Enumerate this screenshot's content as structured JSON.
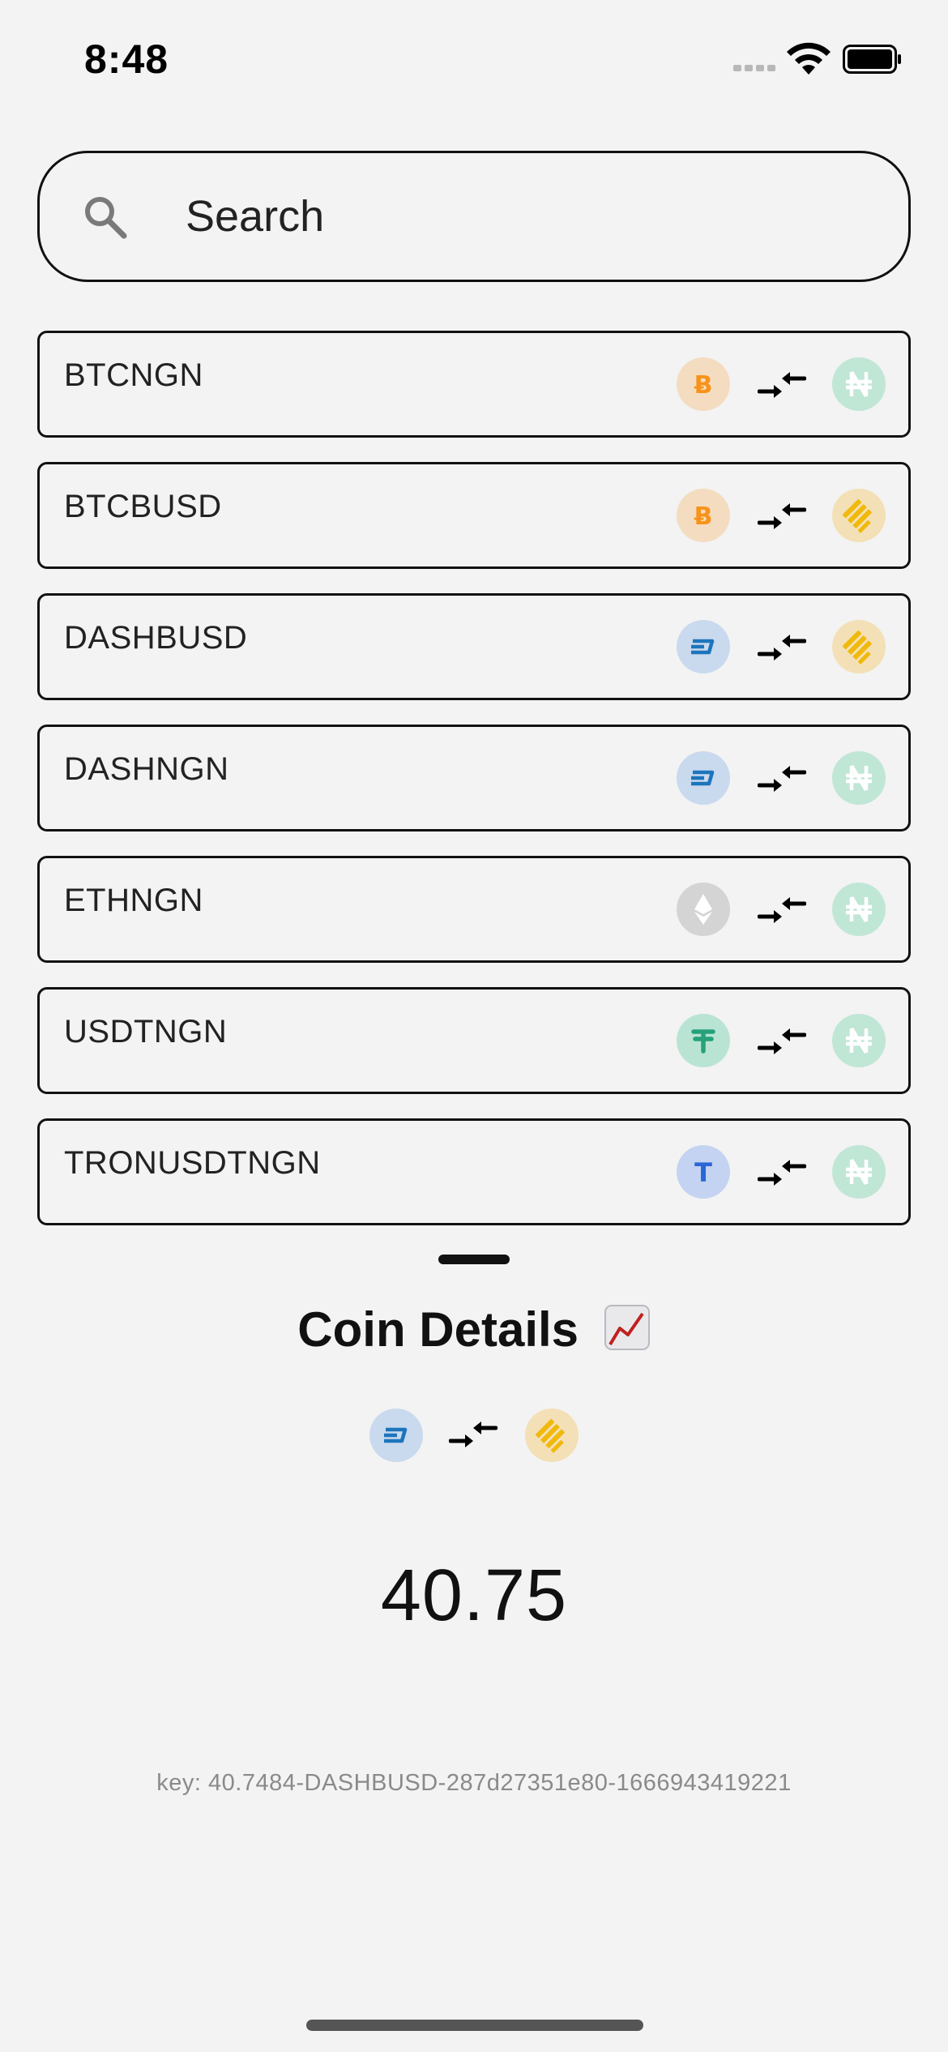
{
  "status_bar": {
    "time": "8:48"
  },
  "search": {
    "placeholder": "Search"
  },
  "pairs": [
    {
      "label": "BTCNGN",
      "base": "btc",
      "quote": "ngn"
    },
    {
      "label": "BTCBUSD",
      "base": "btc",
      "quote": "busd"
    },
    {
      "label": "DASHBUSD",
      "base": "dash",
      "quote": "busd"
    },
    {
      "label": "DASHNGN",
      "base": "dash",
      "quote": "ngn"
    },
    {
      "label": "ETHNGN",
      "base": "eth",
      "quote": "ngn"
    },
    {
      "label": "USDTNGN",
      "base": "usdt",
      "quote": "ngn"
    },
    {
      "label": "TRONUSDTNGN",
      "base": "tron",
      "quote": "ngn"
    }
  ],
  "icons": {
    "btc": "bitcoin-icon",
    "dash": "dash-icon",
    "eth": "ethereum-icon",
    "usdt": "tether-icon",
    "tron": "tron-icon",
    "ngn": "naira-icon",
    "busd": "binance-usd-icon",
    "swap": "swap-arrows-icon"
  },
  "details": {
    "title": "Coin Details",
    "base": "dash",
    "quote": "busd",
    "price": "40.75",
    "key": "key: 40.7484-DASHBUSD-287d27351e80-1666943419221"
  },
  "colors": {
    "background": "#f3f3f3",
    "border": "#111111",
    "btc": "#f7931a",
    "dash": "#1c75bc",
    "usdt": "#26a17b",
    "busd": "#f0b90b",
    "ngn": "#c0e6d6"
  }
}
